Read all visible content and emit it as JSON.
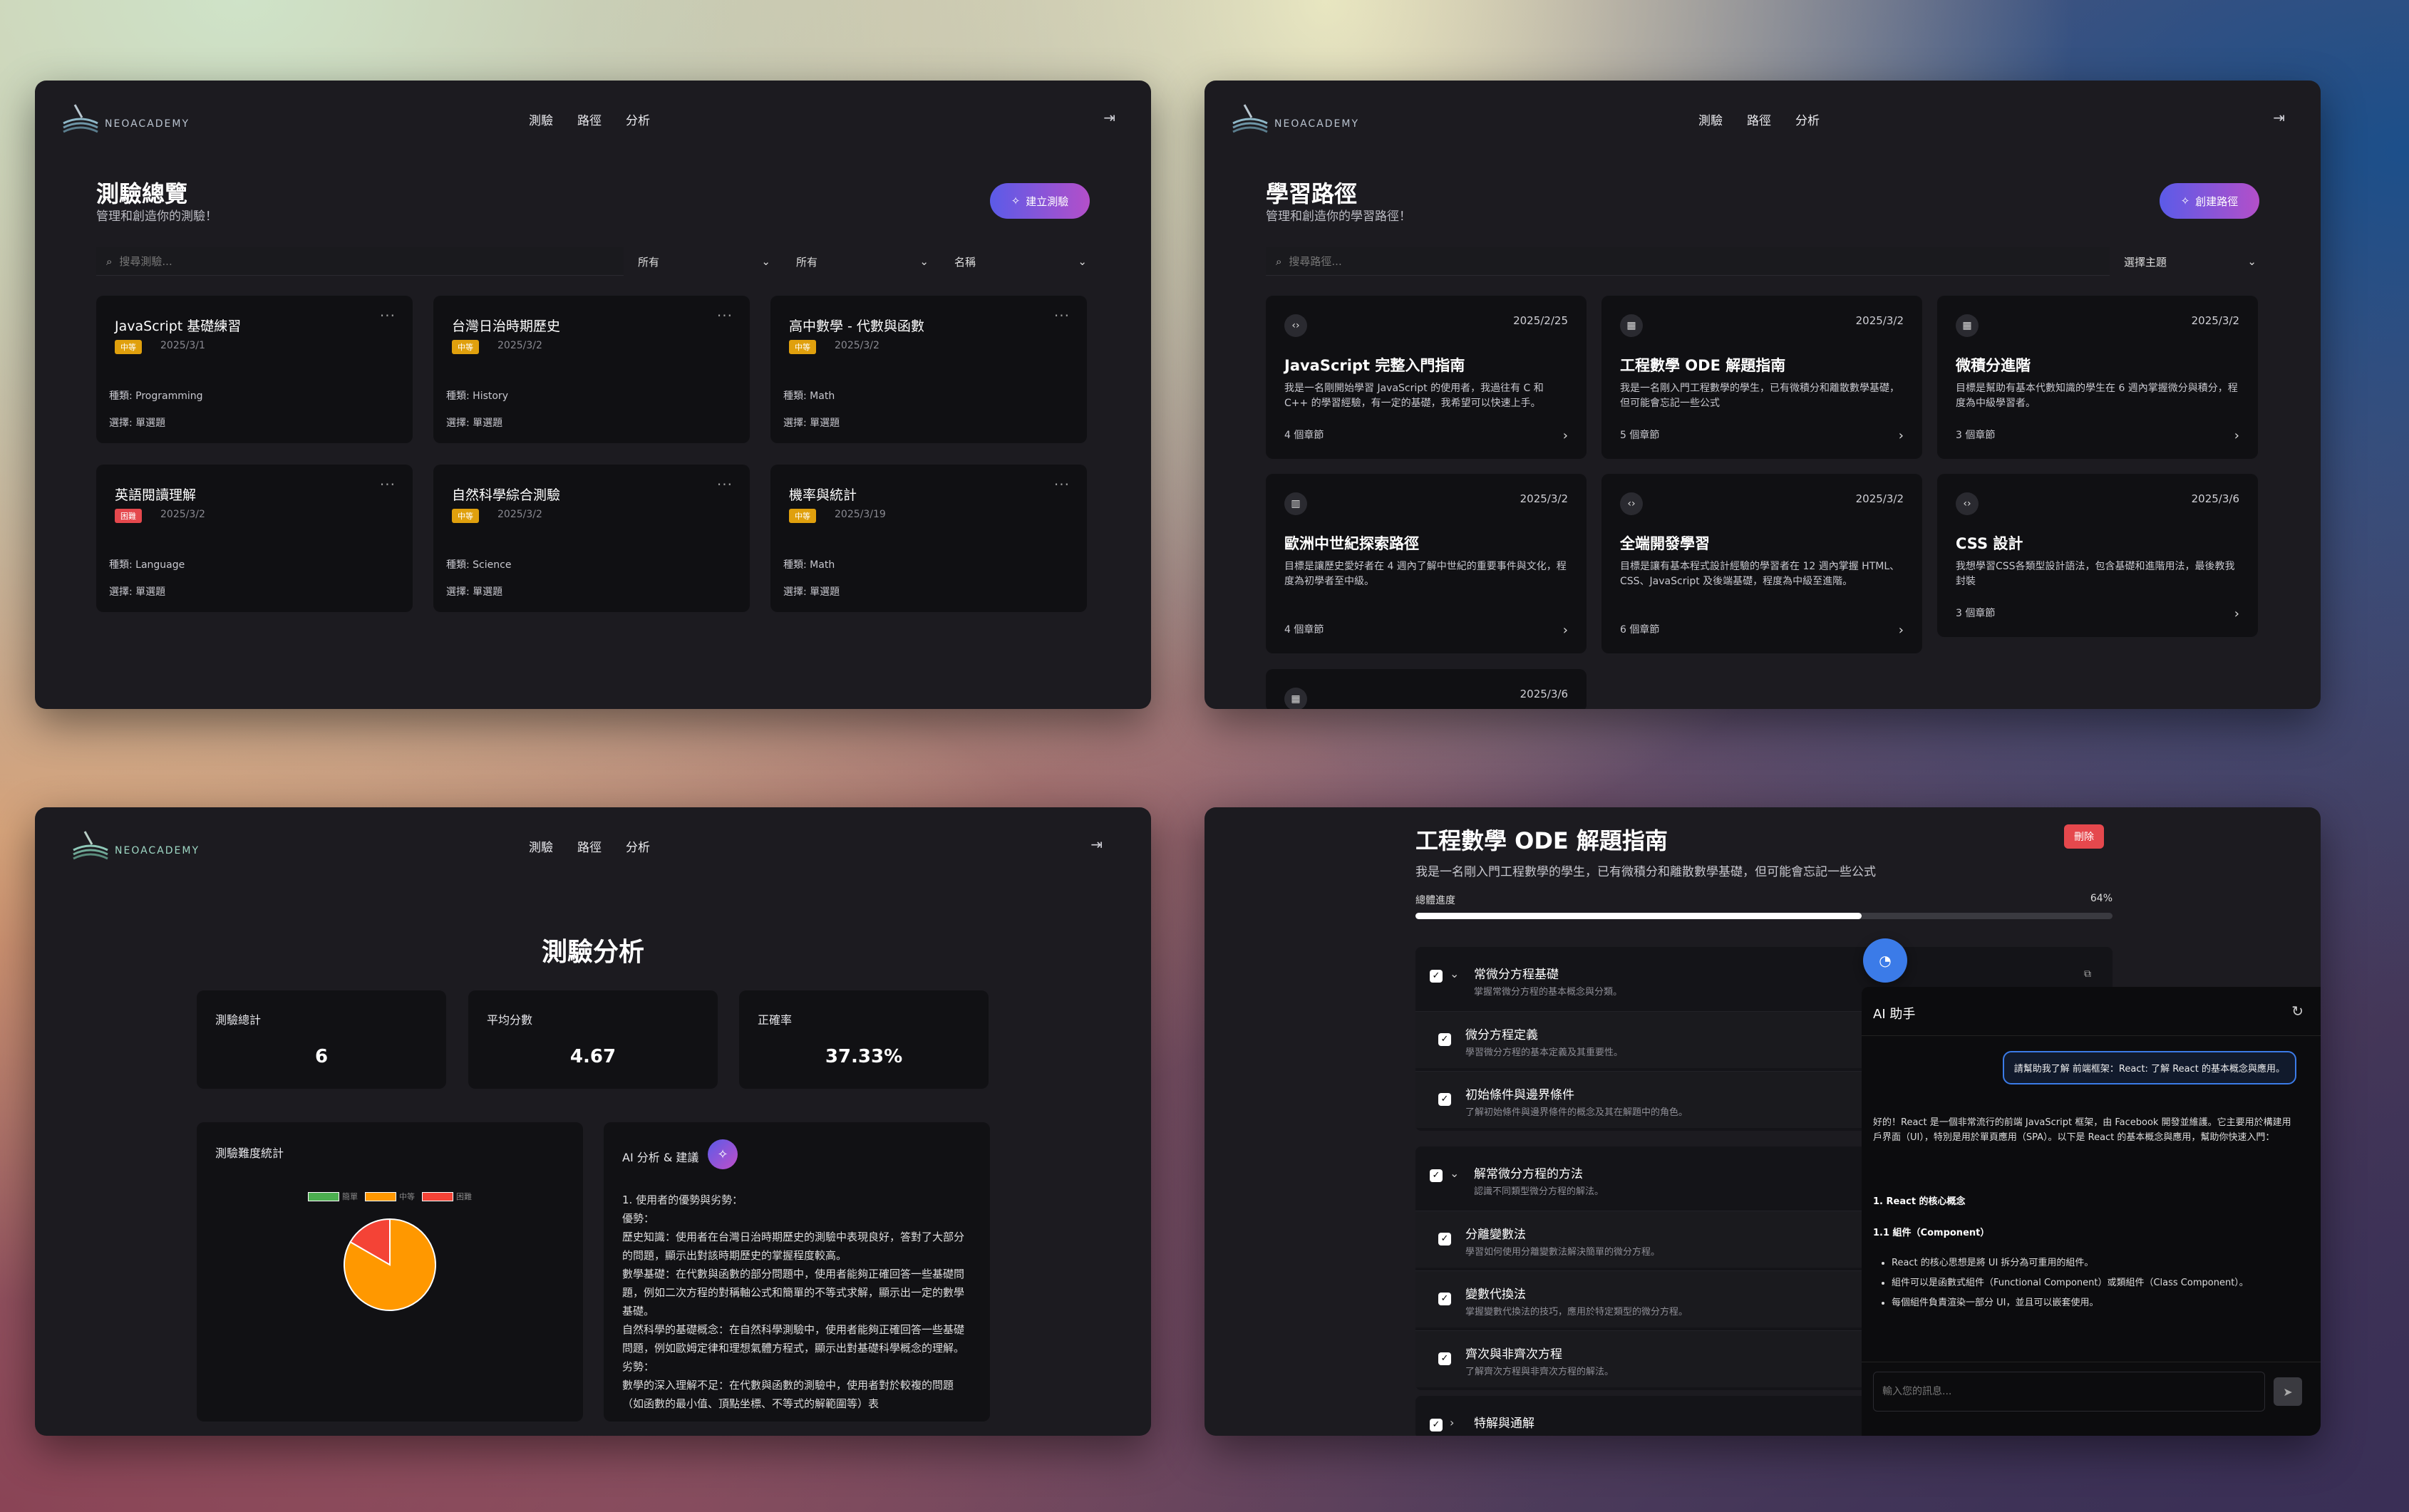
{
  "brand": "NEOACADEMY",
  "nav": [
    "測驗",
    "路徑",
    "分析"
  ],
  "exams": {
    "title": "測驗總覽",
    "subtitle": "管理和創造你的測驗！",
    "create_label": "建立測驗",
    "search_placeholder": "搜尋測驗...",
    "filters": [
      "所有",
      "所有",
      "名稱"
    ],
    "cards": [
      {
        "title": "JavaScript 基礎練習",
        "level": "中等",
        "color": "#e0a00d",
        "date": "2025/3/1",
        "type": "種類: Programming",
        "q": "選擇: 單選題"
      },
      {
        "title": "台灣日治時期歷史",
        "level": "中等",
        "color": "#e0a00d",
        "date": "2025/3/2",
        "type": "種類: History",
        "q": "選擇: 單選題"
      },
      {
        "title": "高中數學 - 代數與函數",
        "level": "中等",
        "color": "#e0a00d",
        "date": "2025/3/2",
        "type": "種類: Math",
        "q": "選擇: 單選題"
      },
      {
        "title": "英語閱讀理解",
        "level": "困難",
        "color": "#e5484d",
        "date": "2025/3/2",
        "type": "種類: Language",
        "q": "選擇: 單選題"
      },
      {
        "title": "自然科學綜合測驗",
        "level": "中等",
        "color": "#e0a00d",
        "date": "2025/3/2",
        "type": "種類: Science",
        "q": "選擇: 單選題"
      },
      {
        "title": "機率與統計",
        "level": "中等",
        "color": "#e0a00d",
        "date": "2025/3/19",
        "type": "種類: Math",
        "q": "選擇: 單選題"
      }
    ]
  },
  "paths": {
    "title": "學習路徑",
    "subtitle": "管理和創造你的學習路徑！",
    "create_label": "創建路徑",
    "search_placeholder": "搜尋路徑...",
    "topic_select": "選擇主題",
    "cards": [
      {
        "icon": "code-icon",
        "glyph": "‹›",
        "date": "2025/2/25",
        "title": "JavaScript 完整入門指南",
        "desc": "我是一名剛開始學習 JavaScript 的使用者，我過往有 C 和 C++ 的學習經驗，有一定的基礎，我希望可以快速上手。",
        "count": "4 個章節"
      },
      {
        "icon": "calculator-icon",
        "glyph": "▦",
        "date": "2025/3/2",
        "title": "工程數學 ODE 解題指南",
        "desc": "我是一名剛入門工程數學的學生，已有微積分和離散數學基礎，但可能會忘記一些公式",
        "count": "5 個章節"
      },
      {
        "icon": "calculator-icon",
        "glyph": "▦",
        "date": "2025/3/2",
        "title": "微積分進階",
        "desc": "目標是幫助有基本代數知識的學生在 6 週內掌握微分與積分，程度為中級學習者。",
        "count": "3 個章節"
      },
      {
        "icon": "book-icon",
        "glyph": "▥",
        "date": "2025/3/2",
        "title": "歐洲中世紀探索路徑",
        "desc": "目標是讓歷史愛好者在 4 週內了解中世紀的重要事件與文化，程度為初學者至中級。",
        "count": "4 個章節"
      },
      {
        "icon": "code-icon",
        "glyph": "‹›",
        "date": "2025/3/2",
        "title": "全端開發學習",
        "desc": "目標是讓有基本程式設計經驗的學習者在 12 週內掌握 HTML、CSS、JavaScript 及後端基礎，程度為中級至進階。",
        "count": "6 個章節"
      },
      {
        "icon": "code-icon",
        "glyph": "‹›",
        "date": "2025/3/6",
        "title": "CSS 設計",
        "desc": "我想學習CSS各類型設計語法，包含基礎和進階用法，最後教我封裝",
        "count": "3 個章節"
      },
      {
        "icon": "calculator-icon",
        "glyph": "▦",
        "date": "2025/3/6",
        "title": "",
        "desc": "",
        "count": ""
      }
    ]
  },
  "analytics": {
    "title": "測驗分析",
    "stats": [
      {
        "label": "測驗總計",
        "value": "6"
      },
      {
        "label": "平均分數",
        "value": "4.67"
      },
      {
        "label": "正確率",
        "value": "37.33%"
      }
    ],
    "difficulty_title": "測驗難度統計",
    "legend": [
      {
        "label": "簡單",
        "color": "#4caf50"
      },
      {
        "label": "中等",
        "color": "#ff9800"
      },
      {
        "label": "困難",
        "color": "#f44336"
      }
    ],
    "ai_title": "AI 分析 & 建議",
    "ai_lines": [
      "1. 使用者的優勢與劣勢：",
      "優勢：",
      "歷史知識：使用者在台灣日治時期歷史的測驗中表現良好，答對了大部分的問題，顯示出對該時期歷史的掌握程度較高。",
      "數學基礎：在代數與函數的部分問題中，使用者能夠正確回答一些基礎問題，例如二次方程的對稱軸公式和簡單的不等式求解，顯示出一定的數學基礎。",
      "自然科學的基礎概念：在自然科學測驗中，使用者能夠正確回答一些基礎問題，例如歐姆定律和理想氣體方程式，顯示出對基礎科學概念的理解。",
      "劣勢：",
      "數學的深入理解不足：在代數與函數的測驗中，使用者對於較複的問題（如函數的最小值、頂點坐標、不等式的解範圍等）表"
    ]
  },
  "chart_data": {
    "type": "pie",
    "title": "測驗難度統計",
    "categories": [
      "簡單",
      "中等",
      "困難"
    ],
    "values": [
      0,
      5,
      1
    ]
  },
  "guide": {
    "title": "工程數學 ODE 解題指南",
    "delete_label": "刪除",
    "desc": "我是一名剛入門工程數學的學生，已有微積分和離散數學基礎，但可能會忘記一些公式",
    "progress_label": "總體進度",
    "progress_text": "64%",
    "progress": 0.64,
    "modules": [
      {
        "title": "常微分方程基礎",
        "sub": "掌握常微分方程的基本概念與分類。",
        "items": [
          {
            "t": "微分方程定義",
            "s": "學習微分方程的基本定義及其重要性。"
          },
          {
            "t": "初始條件與邊界條件",
            "s": "了解初始條件與邊界條件的概念及其在解題中的角色。"
          }
        ]
      },
      {
        "title": "解常微分方程的方法",
        "sub": "認識不同類型微分方程的解法。",
        "items": [
          {
            "t": "分離變數法",
            "s": "學習如何使用分離變數法解決簡單的微分方程。"
          },
          {
            "t": "變數代換法",
            "s": "掌握變數代換法的技巧，應用於特定類型的微分方程。"
          },
          {
            "t": "齊次與非齊次方程",
            "s": "了解齊次方程與非齊次方程的解法。"
          }
        ]
      },
      {
        "title": "特解與通解",
        "sub": "",
        "items": []
      }
    ],
    "chat": {
      "title": "AI 助手",
      "user_msg": "請幫助我了解 前端框架：React: 了解 React 的基本概念與應用。",
      "reply_intro": "好的！React 是一個非常流行的前端 JavaScript 框架，由 Facebook 開發並維護。它主要用於構建用戶界面（UI），特別是用於單頁應用（SPA）。以下是 React 的基本概念與應用，幫助你快速入門：",
      "h1": "1. React 的核心概念",
      "h2": "1.1 組件（Component）",
      "bullets": [
        "React 的核心思想是將 UI 拆分為可重用的組件。",
        "組件可以是函數式組件（Functional Component）或類組件（Class Component）。",
        "每個組件負責渲染一部分 UI，並且可以嵌套使用。"
      ],
      "input_placeholder": "輸入您的訊息..."
    }
  }
}
